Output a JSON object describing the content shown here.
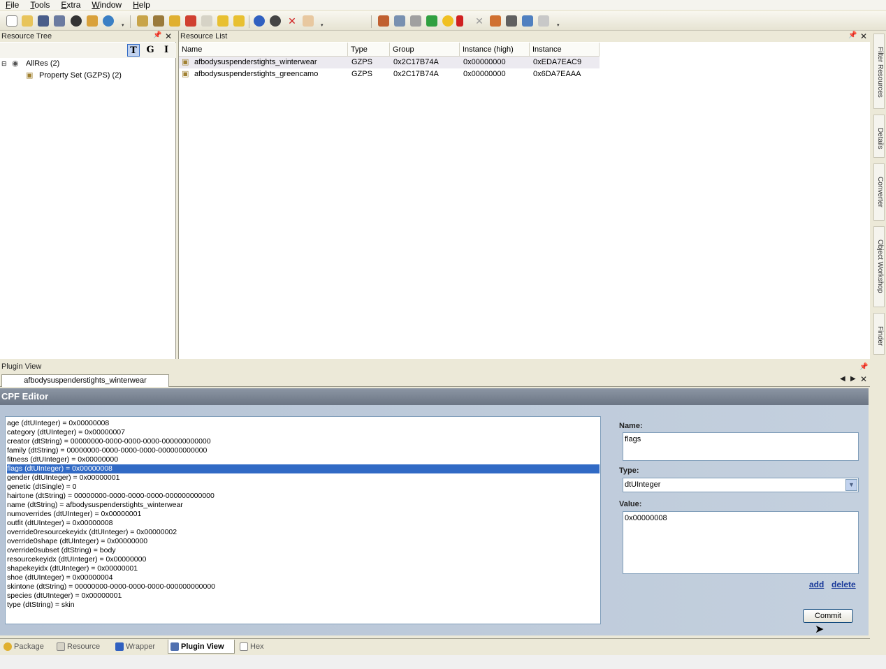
{
  "menu": [
    "File",
    "Tools",
    "Extra",
    "Window",
    "Help"
  ],
  "icons": {
    "tb1": "new-icon",
    "tb2": "open-icon",
    "tb3": "save-icon",
    "tb4": "save-as-icon",
    "tb5": "close-icon",
    "tb6": "import-icon",
    "tb7": "settings-icon",
    "tb8": "folder-open-icon",
    "tb9": "save-folder-icon",
    "tb10": "replace-icon",
    "tb11": "delete-icon",
    "tb12": "comment-icon",
    "tb13": "notes-icon",
    "tb14": "notes-alt-icon",
    "tb15": "refresh-icon",
    "tb16": "user-icon",
    "tb17": "cross-icon",
    "tb18": "eraser-icon",
    "tb19": "package-icon",
    "tb20": "copy-icon",
    "tb21": "chain-icon",
    "tb22": "puzzle-icon",
    "tb23": "badge-icon",
    "tb24": "document-icon",
    "tb25": "cut-icon",
    "tb26": "tools-icon",
    "tb27": "image-icon",
    "tb28": "people-icon",
    "tb29": "disabled-icon"
  },
  "resource_tree": {
    "title": "Resource Tree",
    "modes": [
      "T",
      "G",
      "I"
    ],
    "root": "AllRes (2)",
    "child": "Property Set (GZPS) (2)"
  },
  "resource_list": {
    "title": "Resource List",
    "columns": [
      "Name",
      "Type",
      "Group",
      "Instance (high)",
      "Instance"
    ],
    "rows": [
      [
        "afbodysuspenderstights_winterwear",
        "GZPS",
        "0x2C17B74A",
        "0x00000000",
        "0xEDA7EAC9"
      ],
      [
        "afbodysuspenderstights_greencamo",
        "GZPS",
        "0x2C17B74A",
        "0x00000000",
        "0x6DA7EAAA"
      ]
    ]
  },
  "side_tabs": [
    "Filter Resources",
    "Details",
    "Converter",
    "Object Workshop",
    "Finder"
  ],
  "plugin_view": {
    "title": "Plugin View",
    "doc_tab": "afbodysuspenderstights_winterwear",
    "editor_title": "CPF Editor",
    "properties": [
      "age (dtUInteger) = 0x00000008",
      "category (dtUInteger) = 0x00000007",
      "creator (dtString) = 00000000-0000-0000-0000-000000000000",
      "family (dtString) = 00000000-0000-0000-0000-000000000000",
      "fitness (dtUInteger) = 0x00000000",
      "flags (dtUInteger) = 0x00000008",
      "gender (dtUInteger) = 0x00000001",
      "genetic (dtSingle) = 0",
      "hairtone (dtString) = 00000000-0000-0000-0000-000000000000",
      "name (dtString) = afbodysuspenderstights_winterwear",
      "numoverrides (dtUInteger) = 0x00000001",
      "outfit (dtUInteger) = 0x00000008",
      "override0resourcekeyidx (dtUInteger) = 0x00000002",
      "override0shape (dtUInteger) = 0x00000000",
      "override0subset (dtString) = body",
      "resourcekeyidx (dtUInteger) = 0x00000000",
      "shapekeyidx (dtUInteger) = 0x00000001",
      "shoe (dtUInteger) = 0x00000004",
      "skintone (dtString) = 00000000-0000-0000-0000-000000000000",
      "species (dtUInteger) = 0x00000001",
      "type (dtString) = skin"
    ],
    "name_label": "Name:",
    "name_value": "flags",
    "type_label": "Type:",
    "type_value": "dtUInteger",
    "value_label": "Value:",
    "value_value": "0x00000008",
    "add_link": "add",
    "delete_link": "delete",
    "commit_button": "Commit"
  },
  "bottom_tabs": [
    "Package",
    "Resource",
    "Wrapper",
    "Plugin View",
    "Hex"
  ],
  "colors": {
    "selection": "#316ac5",
    "editor_header": "#6b7584",
    "editor_body": "#b6c4d6"
  }
}
